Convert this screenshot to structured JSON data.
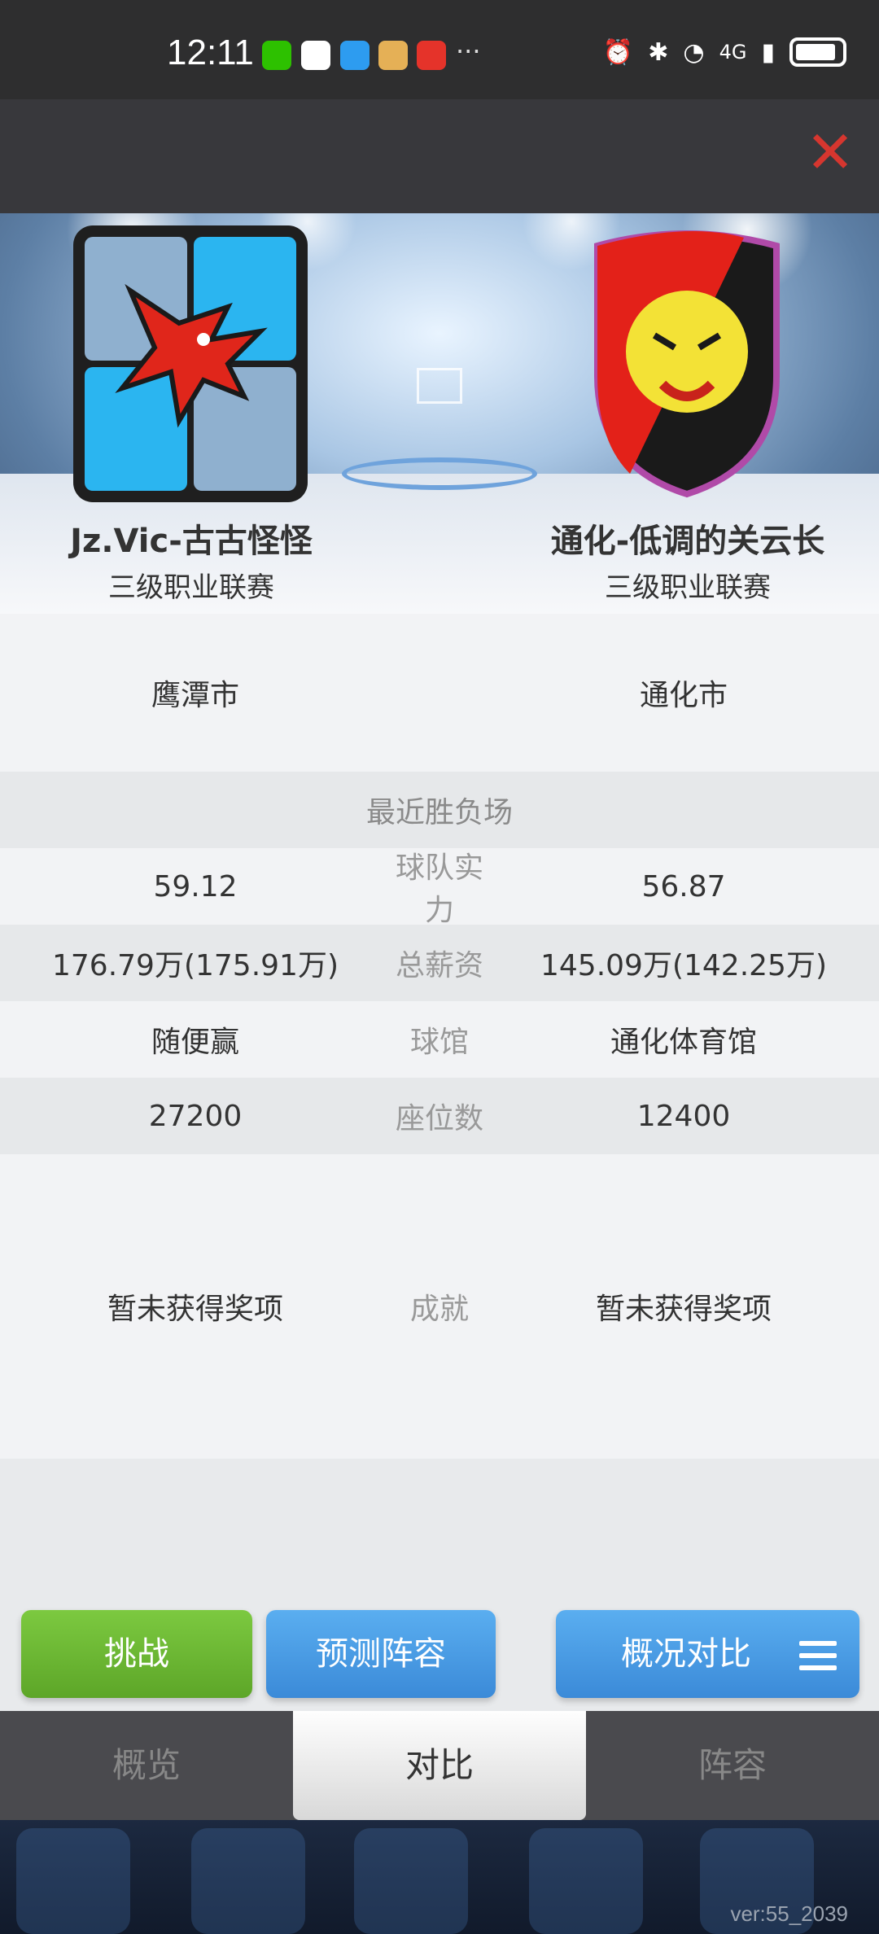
{
  "status_bar": {
    "time": "12:11",
    "app_icons": [
      {
        "name": "wechat",
        "color": "#2dc100"
      },
      {
        "name": "qq",
        "color": "#ffffff"
      },
      {
        "name": "message",
        "color": "#2d9cf0"
      },
      {
        "name": "app-orange",
        "color": "#e5b056"
      },
      {
        "name": "ting",
        "color": "#e5332a"
      }
    ],
    "more": "···",
    "network": "4G"
  },
  "teams": {
    "left": {
      "name": "Jz.Vic-古古怪怪",
      "league": "三级职业联赛",
      "city": "鹰潭市",
      "strength": "59.12",
      "salary": "176.79万(175.91万)",
      "arena": "随便赢",
      "seats": "27200",
      "achievement": "暂未获得奖项"
    },
    "right": {
      "name": "通化-低调的关云长",
      "league": "三级职业联赛",
      "city": "通化市",
      "strength": "56.87",
      "salary": "145.09万(142.25万)",
      "arena": "通化体育馆",
      "seats": "12400",
      "achievement": "暂未获得奖项"
    }
  },
  "labels": {
    "recent": "最近胜负场",
    "strength": "球队实力",
    "salary": "总薪资",
    "arena": "球馆",
    "seats": "座位数",
    "achievement": "成就"
  },
  "buttons": {
    "challenge": "挑战",
    "predict": "预测阵容",
    "overview": "概况对比"
  },
  "tabs": [
    {
      "label": "概览",
      "active": false
    },
    {
      "label": "对比",
      "active": true
    },
    {
      "label": "阵容",
      "active": false
    }
  ],
  "version": "ver:55_2039"
}
